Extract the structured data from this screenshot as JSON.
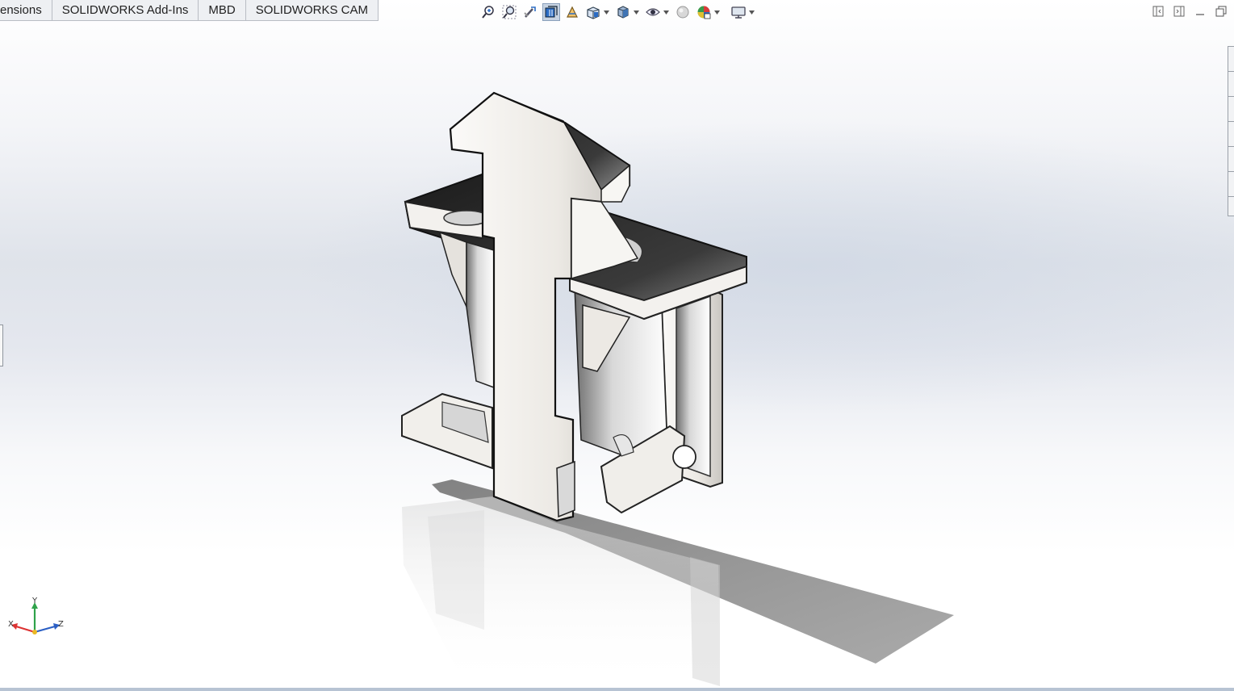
{
  "tabs": [
    {
      "label": "ensions"
    },
    {
      "label": "SOLIDWORKS Add-Ins"
    },
    {
      "label": "MBD"
    },
    {
      "label": "SOLIDWORKS CAM"
    }
  ],
  "heads_up_toolbar": [
    {
      "icon": "zoom-to-fit-icon"
    },
    {
      "icon": "zoom-to-area-icon"
    },
    {
      "icon": "previous-view-icon"
    },
    {
      "icon": "section-view-icon",
      "active": true
    },
    {
      "icon": "dynamic-annotation-views-icon"
    },
    {
      "icon": "view-orientation-icon"
    },
    {
      "icon": "display-style-icon"
    },
    {
      "icon": "hide-show-items-icon"
    },
    {
      "icon": "edit-appearance-icon"
    },
    {
      "icon": "apply-scene-icon"
    },
    {
      "icon": "view-settings-icon"
    }
  ],
  "triad": {
    "x": "X",
    "y": "Y",
    "z": "Z"
  },
  "colors": {
    "accent": "#3c6fb0",
    "model_face": "#eeebe6",
    "model_dark": "#2b2b2b"
  }
}
